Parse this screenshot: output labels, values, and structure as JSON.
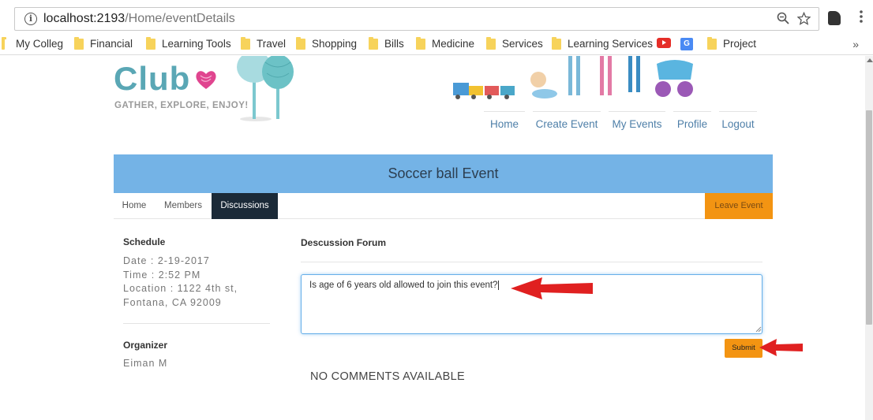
{
  "browser": {
    "url_host": "localhost:2193",
    "url_path": "/Home/eventDetails",
    "bookmarks": [
      {
        "label": "My Colleg",
        "icon": "folder-icon"
      },
      {
        "label": "Financial",
        "icon": "folder-icon"
      },
      {
        "label": "Learning Tools",
        "icon": "folder-icon"
      },
      {
        "label": "Travel",
        "icon": "folder-icon"
      },
      {
        "label": "Shopping",
        "icon": "folder-icon"
      },
      {
        "label": "Bills",
        "icon": "folder-icon"
      },
      {
        "label": "Medicine",
        "icon": "folder-icon"
      },
      {
        "label": "Services",
        "icon": "folder-icon"
      },
      {
        "label": "Learning Services",
        "icon": "folder-icon"
      },
      {
        "label": "",
        "icon": "youtube-icon"
      },
      {
        "label": "",
        "icon": "google-translate-icon"
      },
      {
        "label": "Project",
        "icon": "folder-icon"
      }
    ],
    "more_label": "»"
  },
  "site": {
    "logo": "Club",
    "tagline": "GATHER, EXPLORE, ENJOY!",
    "nav": [
      "Home",
      "Create Event",
      "My Events",
      "Profile",
      "Logout"
    ]
  },
  "event": {
    "title": "Soccer ball Event",
    "tabs": [
      "Home",
      "Members",
      "Discussions"
    ],
    "active_tab": "Discussions",
    "leave_label": "Leave Event"
  },
  "schedule": {
    "heading": "Schedule",
    "date": "Date : 2-19-2017",
    "time": "Time : 2:52 PM",
    "location_line1": "Location : 1122 4th st,",
    "location_line2": "Fontana, CA 92009"
  },
  "organizer": {
    "heading": "Organizer",
    "name": "Eiman M"
  },
  "forum": {
    "title": "Descussion Forum",
    "comment_value": "Is age of 6 years old allowed to join this event?",
    "submit_label": "Submit",
    "empty_label": "NO COMMENTS AVAILABLE"
  },
  "colors": {
    "banner": "#74b3e6",
    "accent_orange": "#f39412",
    "active_tab": "#1b2a38",
    "annotation_arrow": "#e02020"
  }
}
